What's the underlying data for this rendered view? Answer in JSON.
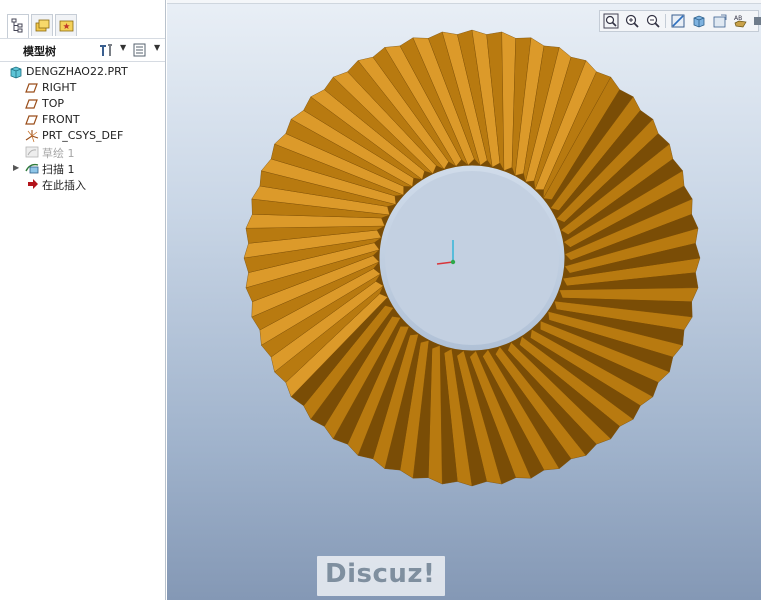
{
  "model_tree": {
    "title": "模型树",
    "items": [
      {
        "label": "DENGZHAO22.PRT",
        "icon": "part-icon",
        "indent": 0
      },
      {
        "label": "RIGHT",
        "icon": "datum-plane-icon",
        "indent": 1
      },
      {
        "label": "TOP",
        "icon": "datum-plane-icon",
        "indent": 1
      },
      {
        "label": "FRONT",
        "icon": "datum-plane-icon",
        "indent": 1
      },
      {
        "label": "PRT_CSYS_DEF",
        "icon": "coordinate-system-icon",
        "indent": 1
      },
      {
        "label": "草绘 1",
        "icon": "sketch-icon",
        "indent": 1,
        "dimmed": true
      },
      {
        "label": "扫描 1",
        "icon": "sweep-icon",
        "indent": 1,
        "expandable": true
      },
      {
        "label": "在此插入",
        "icon": "insert-here-arrow-icon",
        "indent": 1
      }
    ]
  },
  "panel_tabs": [
    "model-tree-tab-icon",
    "folder-browser-tab-icon",
    "favorites-tab-icon"
  ],
  "view_toolbar": [
    "refit-icon",
    "zoom-in-icon",
    "zoom-out-icon",
    "repaint-icon",
    "display-style-icon",
    "saved-views-icon",
    "datum-display-icon",
    "spin-center-icon"
  ],
  "watermark": "Discuz!",
  "colors": {
    "gear": "#b87a10",
    "gear_dark": "#7a4d06",
    "gear_light": "#dc9a2a"
  }
}
